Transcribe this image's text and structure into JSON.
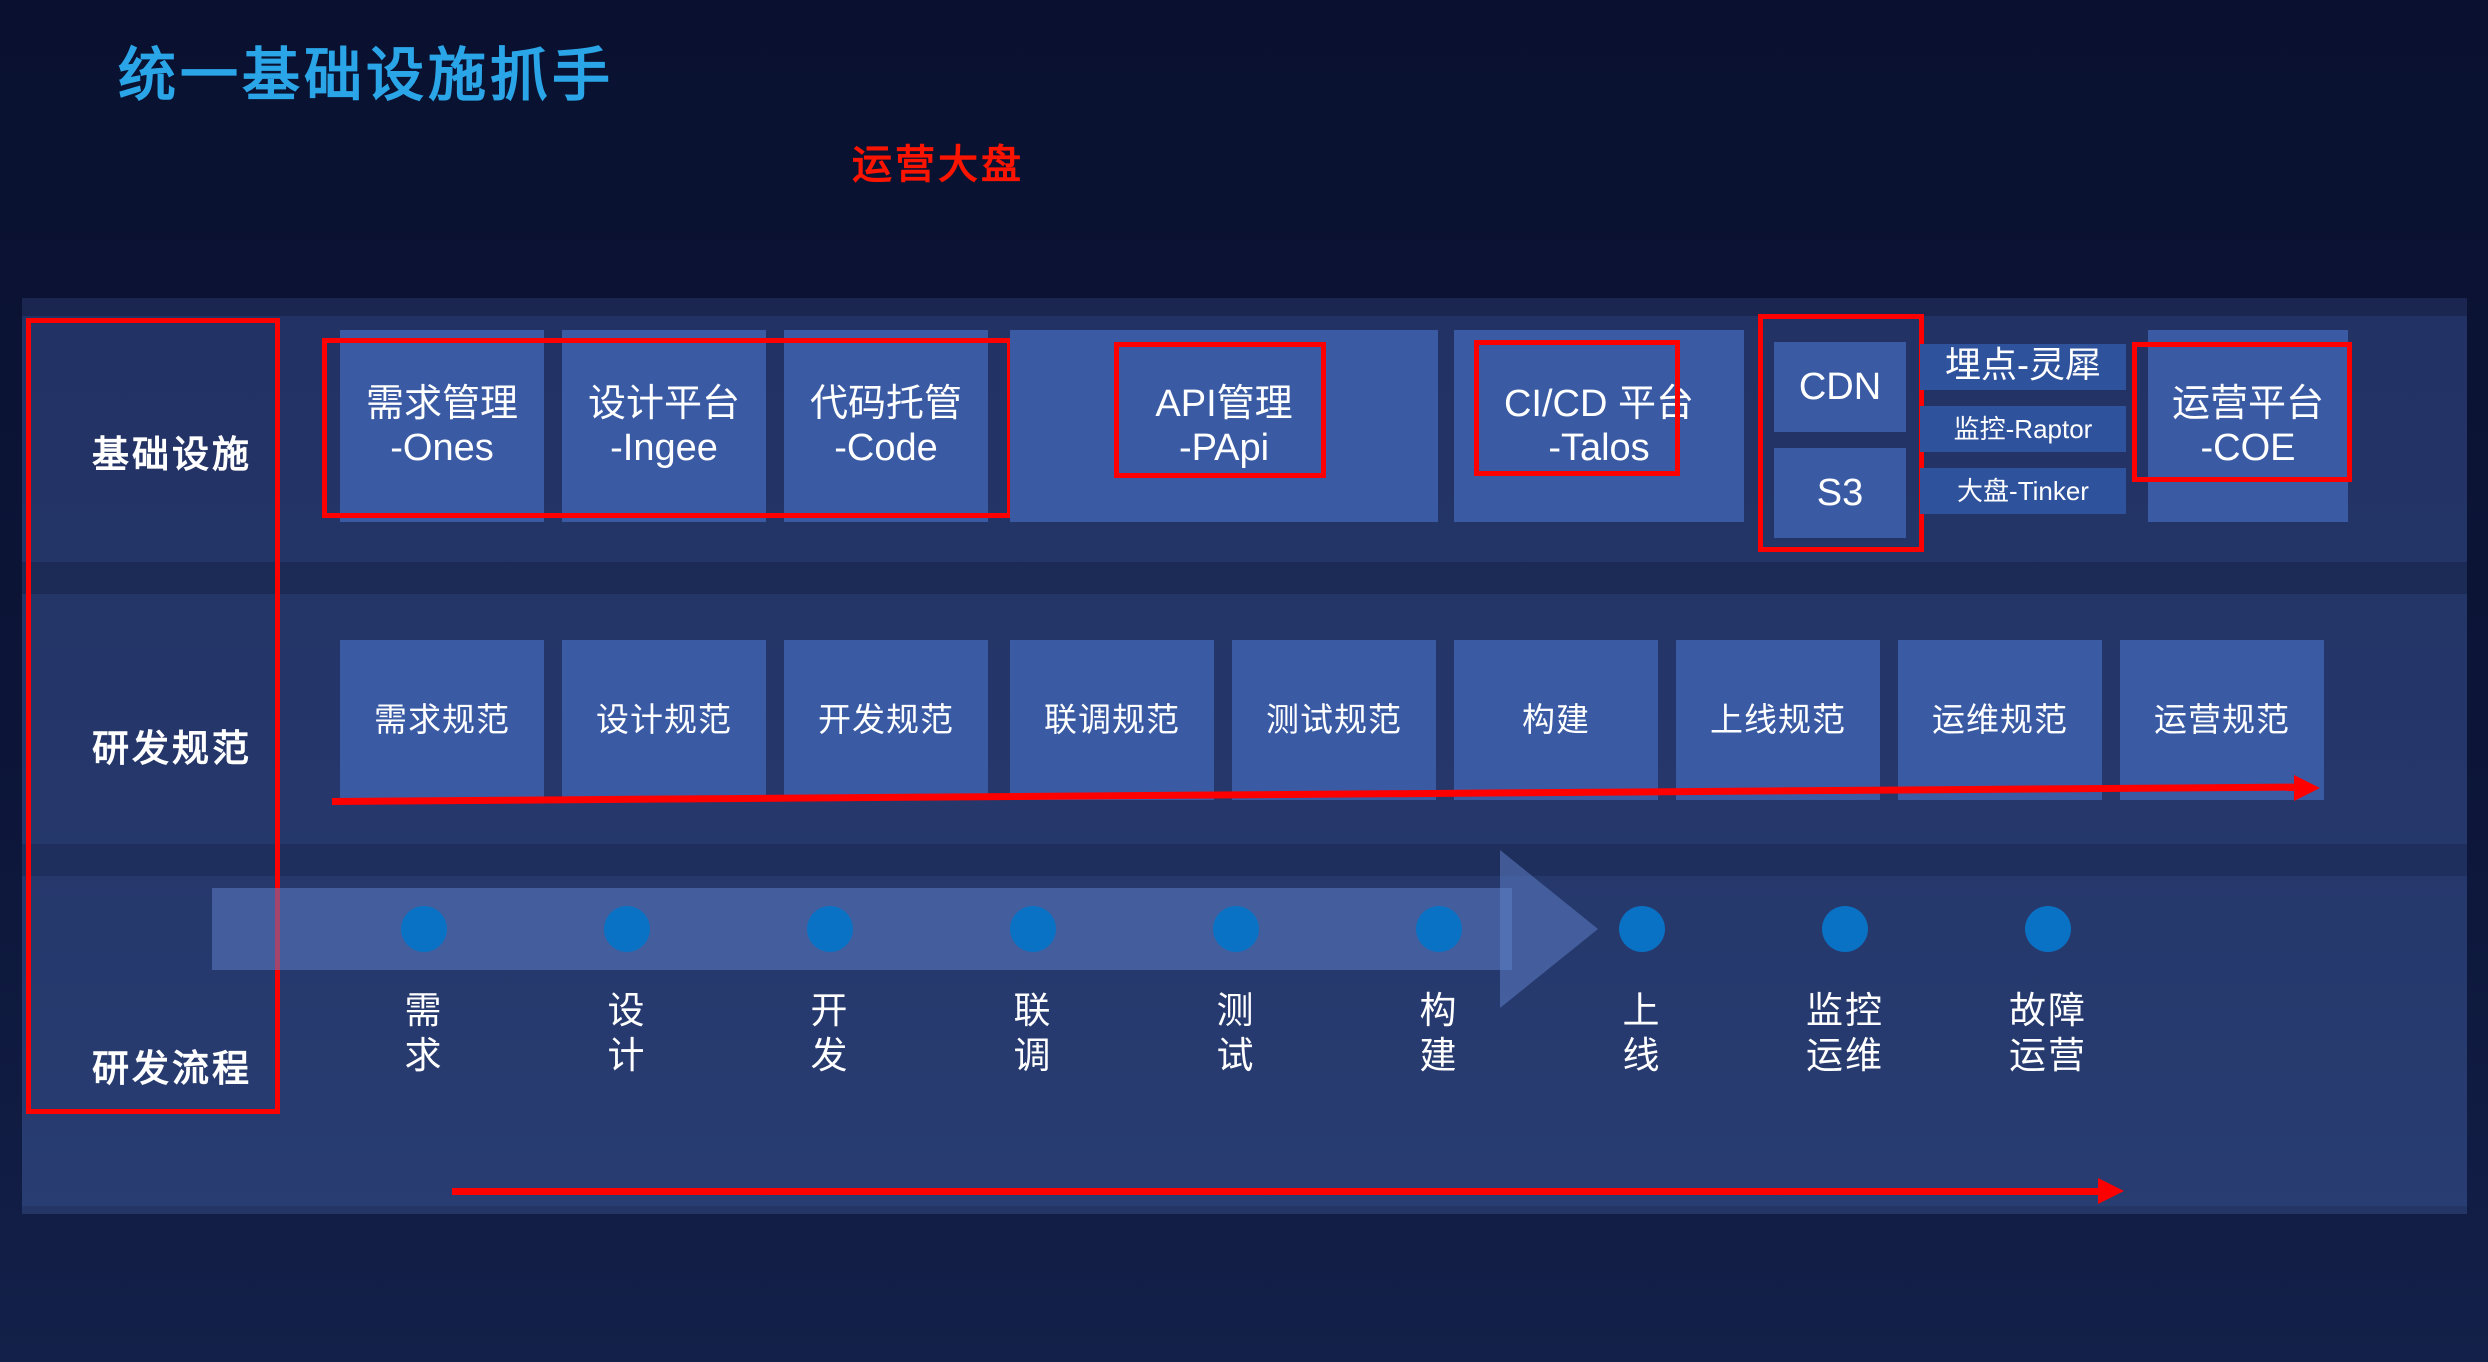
{
  "heading": {
    "title": "统一基础设施抓手",
    "subtitle": "运营大盘",
    "title_color": "#2aa5e8",
    "subtitle_color": "#fb1400"
  },
  "rows": {
    "infrastructure_label": "基础设施",
    "standards_label": "研发规范",
    "process_label": "研发流程"
  },
  "infrastructure": {
    "ones_top": "需求管理",
    "ones_bottom": "-Ones",
    "ingee_top": "设计平台",
    "ingee_bottom": "-Ingee",
    "code_top": "代码托管",
    "code_bottom": "-Code",
    "papi_top": "API管理",
    "papi_bottom": "-PApi",
    "talos_top": "CI/CD 平台",
    "talos_bottom": "-Talos",
    "cdn": "CDN",
    "s3": "S3",
    "lingxi": "埋点-灵犀",
    "raptor": "监控-Raptor",
    "tinker": "大盘-Tinker",
    "coe_top": "运营平台",
    "coe_bottom": "-COE"
  },
  "standards": [
    "需求规范",
    "设计规范",
    "开发规范",
    "联调规范",
    "测试规范",
    "构建",
    "上线规范",
    "运维规范",
    "运营规范"
  ],
  "process": [
    "需\n求",
    "设\n计",
    "开\n发",
    "联\n调",
    "测\n试",
    "构\n建",
    "上\n线",
    "监控\n运维",
    "故障\n运营"
  ],
  "colors": {
    "background": "#0b1233",
    "panel": "#1d2b58",
    "tile": "#3a5ba4",
    "dot": "#0a72c4",
    "highlight": "#ff0000",
    "text": "#ffffff"
  }
}
